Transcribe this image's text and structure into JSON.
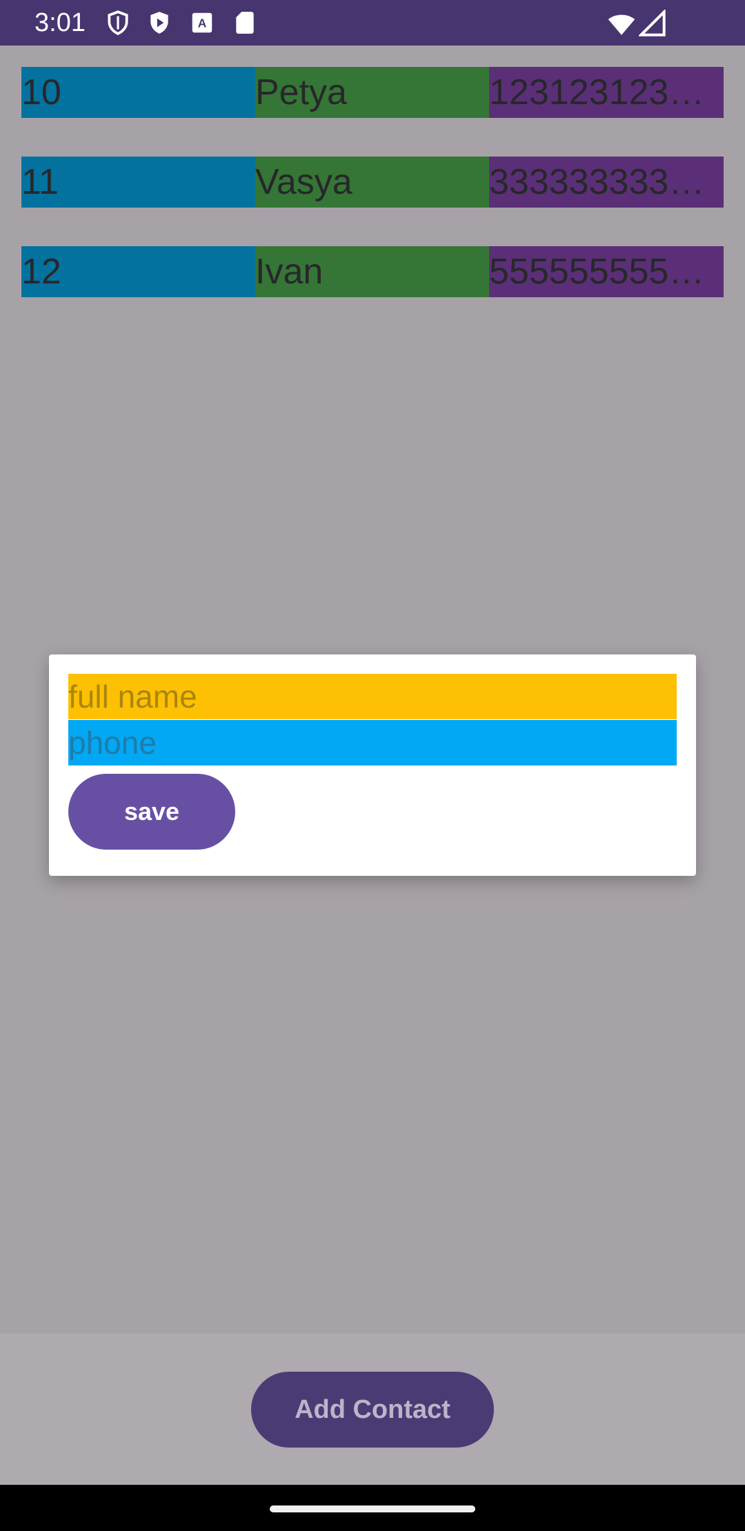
{
  "status_bar": {
    "time": "3:01",
    "icons_left": [
      "shield-icon",
      "play-store-icon",
      "a-icon",
      "sd-card-icon"
    ],
    "icons_right": [
      "wifi-icon",
      "signal-icon"
    ]
  },
  "contacts": [
    {
      "id": "10",
      "name": "Petya",
      "phone": "123123123…"
    },
    {
      "id": "11",
      "name": "Vasya",
      "phone": "333333333…"
    },
    {
      "id": "12",
      "name": "Ivan",
      "phone": "555555555…"
    }
  ],
  "dialog": {
    "name_placeholder": "full name",
    "phone_placeholder": "phone",
    "save_label": "save"
  },
  "bottom": {
    "add_label": "Add Contact"
  },
  "colors": {
    "id_cell": "#03729f",
    "name_cell": "#357636",
    "phone_cell": "#5b2f77",
    "name_field": "#fec002",
    "phone_field": "#02a8f4",
    "primary": "#6750a4"
  }
}
